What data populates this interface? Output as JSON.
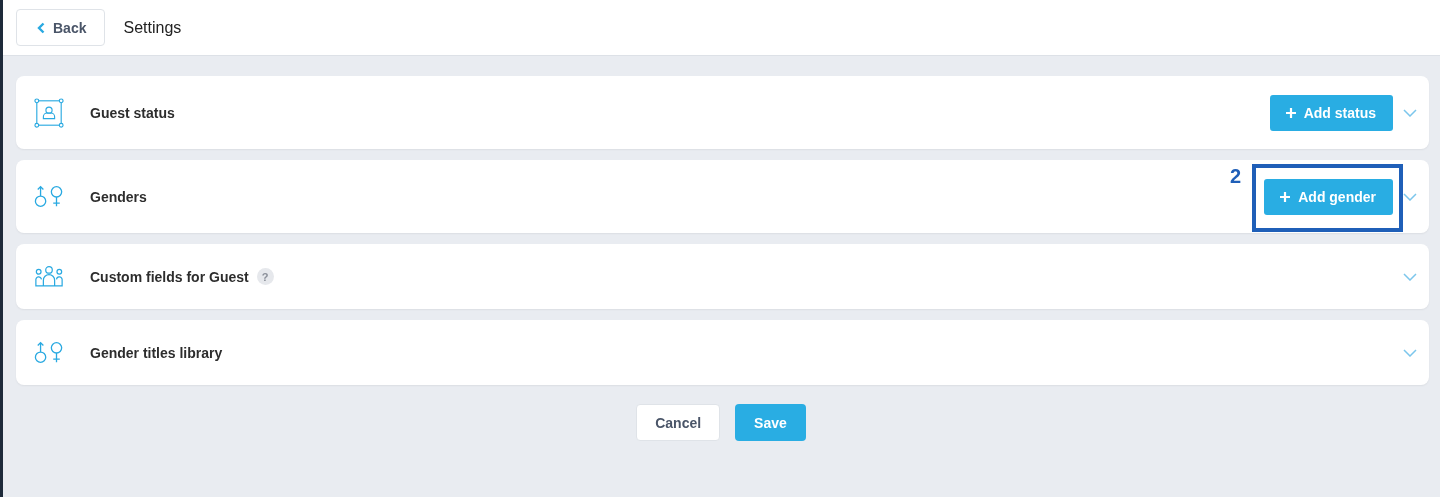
{
  "header": {
    "back": "Back",
    "title": "Settings"
  },
  "sections": [
    {
      "kind": "status",
      "title": "Guest status",
      "button": "Add status"
    },
    {
      "kind": "gender",
      "title": "Genders",
      "button": "Add gender",
      "annotation": "2"
    },
    {
      "kind": "fields",
      "title": "Custom fields for Guest",
      "help": "?"
    },
    {
      "kind": "gender",
      "title": "Gender titles library"
    }
  ],
  "footer": {
    "cancel": "Cancel",
    "save": "Save"
  }
}
